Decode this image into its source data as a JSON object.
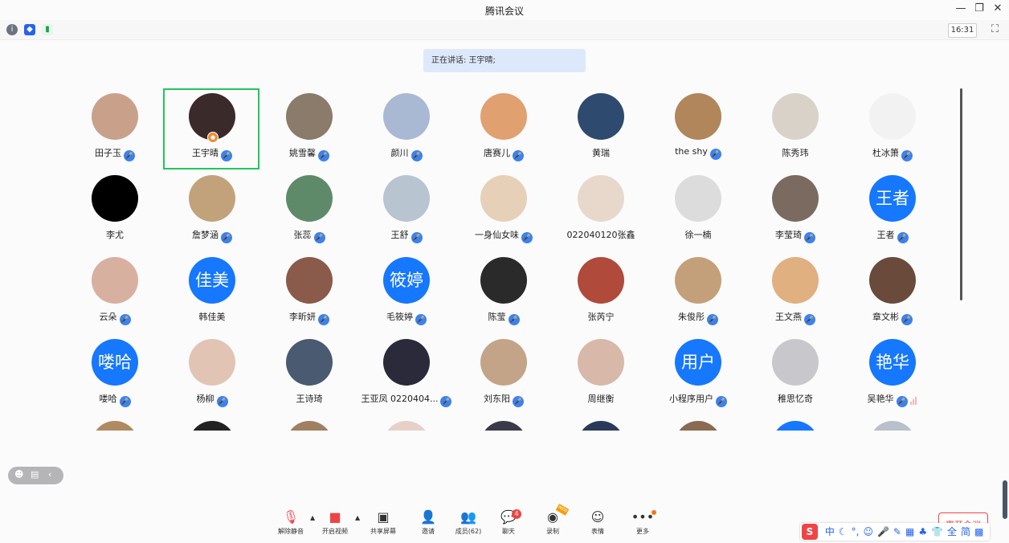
{
  "window": {
    "title": "腾讯会议",
    "minimize": "—",
    "restore": "❐",
    "close": "✕"
  },
  "toolbar": {
    "time": "16:31",
    "fullscreen_icon": "⛶"
  },
  "speaking": {
    "text": "正在讲话: 王宇晴;"
  },
  "participants": [
    {
      "name": "田子玉",
      "mic": true,
      "color": "#c9a18a"
    },
    {
      "name": "王宇晴",
      "mic": true,
      "color": "#3a2a2a",
      "host": true,
      "active": true
    },
    {
      "name": "姚雪馨",
      "mic": true,
      "color": "#8a7b6a"
    },
    {
      "name": "颜川",
      "mic": true,
      "color": "#a9b9d4"
    },
    {
      "name": "唐赛儿",
      "mic": true,
      "color": "#e0a070"
    },
    {
      "name": "黄瑞",
      "mic": false,
      "color": "#2e4a6e"
    },
    {
      "name": "the shy",
      "mic": true,
      "color": "#b0865a"
    },
    {
      "name": "陈秀玮",
      "mic": false,
      "color": "#d8d2c8"
    },
    {
      "name": "杜冰箫",
      "mic": true,
      "color": "#f2f2f2"
    },
    {
      "name": "李尤",
      "mic": false,
      "color": "#000000"
    },
    {
      "name": "詹梦涵",
      "mic": true,
      "color": "#c2a27a"
    },
    {
      "name": "张蕊",
      "mic": true,
      "color": "#5f8a6a"
    },
    {
      "name": "王舒",
      "mic": true,
      "color": "#b8c4cf"
    },
    {
      "name": "一身仙女味",
      "mic": true,
      "color": "#e6d0b8"
    },
    {
      "name": "022040120张鑫",
      "mic": false,
      "color": "#e8d8cc"
    },
    {
      "name": "徐一楠",
      "mic": false,
      "color": "#dcdcdc"
    },
    {
      "name": "李莹琦",
      "mic": true,
      "color": "#7a6a60"
    },
    {
      "name": "王者",
      "mic": true,
      "color": "#1677ff",
      "text": "王者"
    },
    {
      "name": "云朵",
      "mic": true,
      "color": "#d8b0a0"
    },
    {
      "name": "韩佳美",
      "mic": false,
      "color": "#1677ff",
      "text": "佳美"
    },
    {
      "name": "李昕妍",
      "mic": true,
      "color": "#8a5a4a"
    },
    {
      "name": "毛筱婷",
      "mic": true,
      "color": "#1677ff",
      "text": "筱婷"
    },
    {
      "name": "陈莹",
      "mic": true,
      "color": "#2a2a2a"
    },
    {
      "name": "张芮宁",
      "mic": false,
      "color": "#b04a3a"
    },
    {
      "name": "朱俊彤",
      "mic": true,
      "color": "#c4a07a"
    },
    {
      "name": "王文燕",
      "mic": true,
      "color": "#e0b080"
    },
    {
      "name": "章文彬",
      "mic": true,
      "color": "#6a4a3a"
    },
    {
      "name": "喽哈",
      "mic": true,
      "color": "#1677ff",
      "text": "喽哈"
    },
    {
      "name": "杨柳",
      "mic": true,
      "color": "#e2c4b4"
    },
    {
      "name": "王诗琦",
      "mic": false,
      "color": "#4a5a70"
    },
    {
      "name": "王亚凤 0220404...",
      "mic": true,
      "color": "#2a2a3a"
    },
    {
      "name": "刘东阳",
      "mic": true,
      "color": "#c4a488"
    },
    {
      "name": "周继衡",
      "mic": false,
      "color": "#d8b8a8"
    },
    {
      "name": "小程序用户",
      "mic": true,
      "color": "#1677ff",
      "text": "用户"
    },
    {
      "name": "稚思忆奇",
      "mic": false,
      "color": "#c8c8cc"
    },
    {
      "name": "吴艳华",
      "mic": true,
      "color": "#1677ff",
      "text": "艳华",
      "bars": true
    },
    {
      "name": "",
      "mic": false,
      "color": "#b08a60"
    },
    {
      "name": "",
      "mic": false,
      "color": "#222222"
    },
    {
      "name": "",
      "mic": false,
      "color": "#a08060"
    },
    {
      "name": "",
      "mic": false,
      "color": "#e8d0c8"
    },
    {
      "name": "",
      "mic": false,
      "color": "#3a3a4a"
    },
    {
      "name": "",
      "mic": false,
      "color": "#2a3a5a"
    },
    {
      "name": "",
      "mic": false,
      "color": "#8a6a50"
    },
    {
      "name": "",
      "mic": false,
      "color": "#1677ff"
    },
    {
      "name": "",
      "mic": false,
      "color": "#b8c0cc"
    }
  ],
  "bottom": {
    "unmute": "解除静音",
    "start_video": "开启视频",
    "share_screen": "共享屏幕",
    "invite": "邀请",
    "members": "成员(62)",
    "chat": "聊天",
    "chat_badge": "4",
    "record": "录制",
    "new_tag": "NEW",
    "emoji": "表情",
    "more": "更多",
    "leave": "离开会议"
  },
  "ime": {
    "logo": "S",
    "items": [
      "中",
      "☾",
      "°,",
      "☺",
      "🎤",
      "✎",
      "▦",
      "♣",
      "👕",
      "全",
      "简",
      "▩"
    ]
  }
}
